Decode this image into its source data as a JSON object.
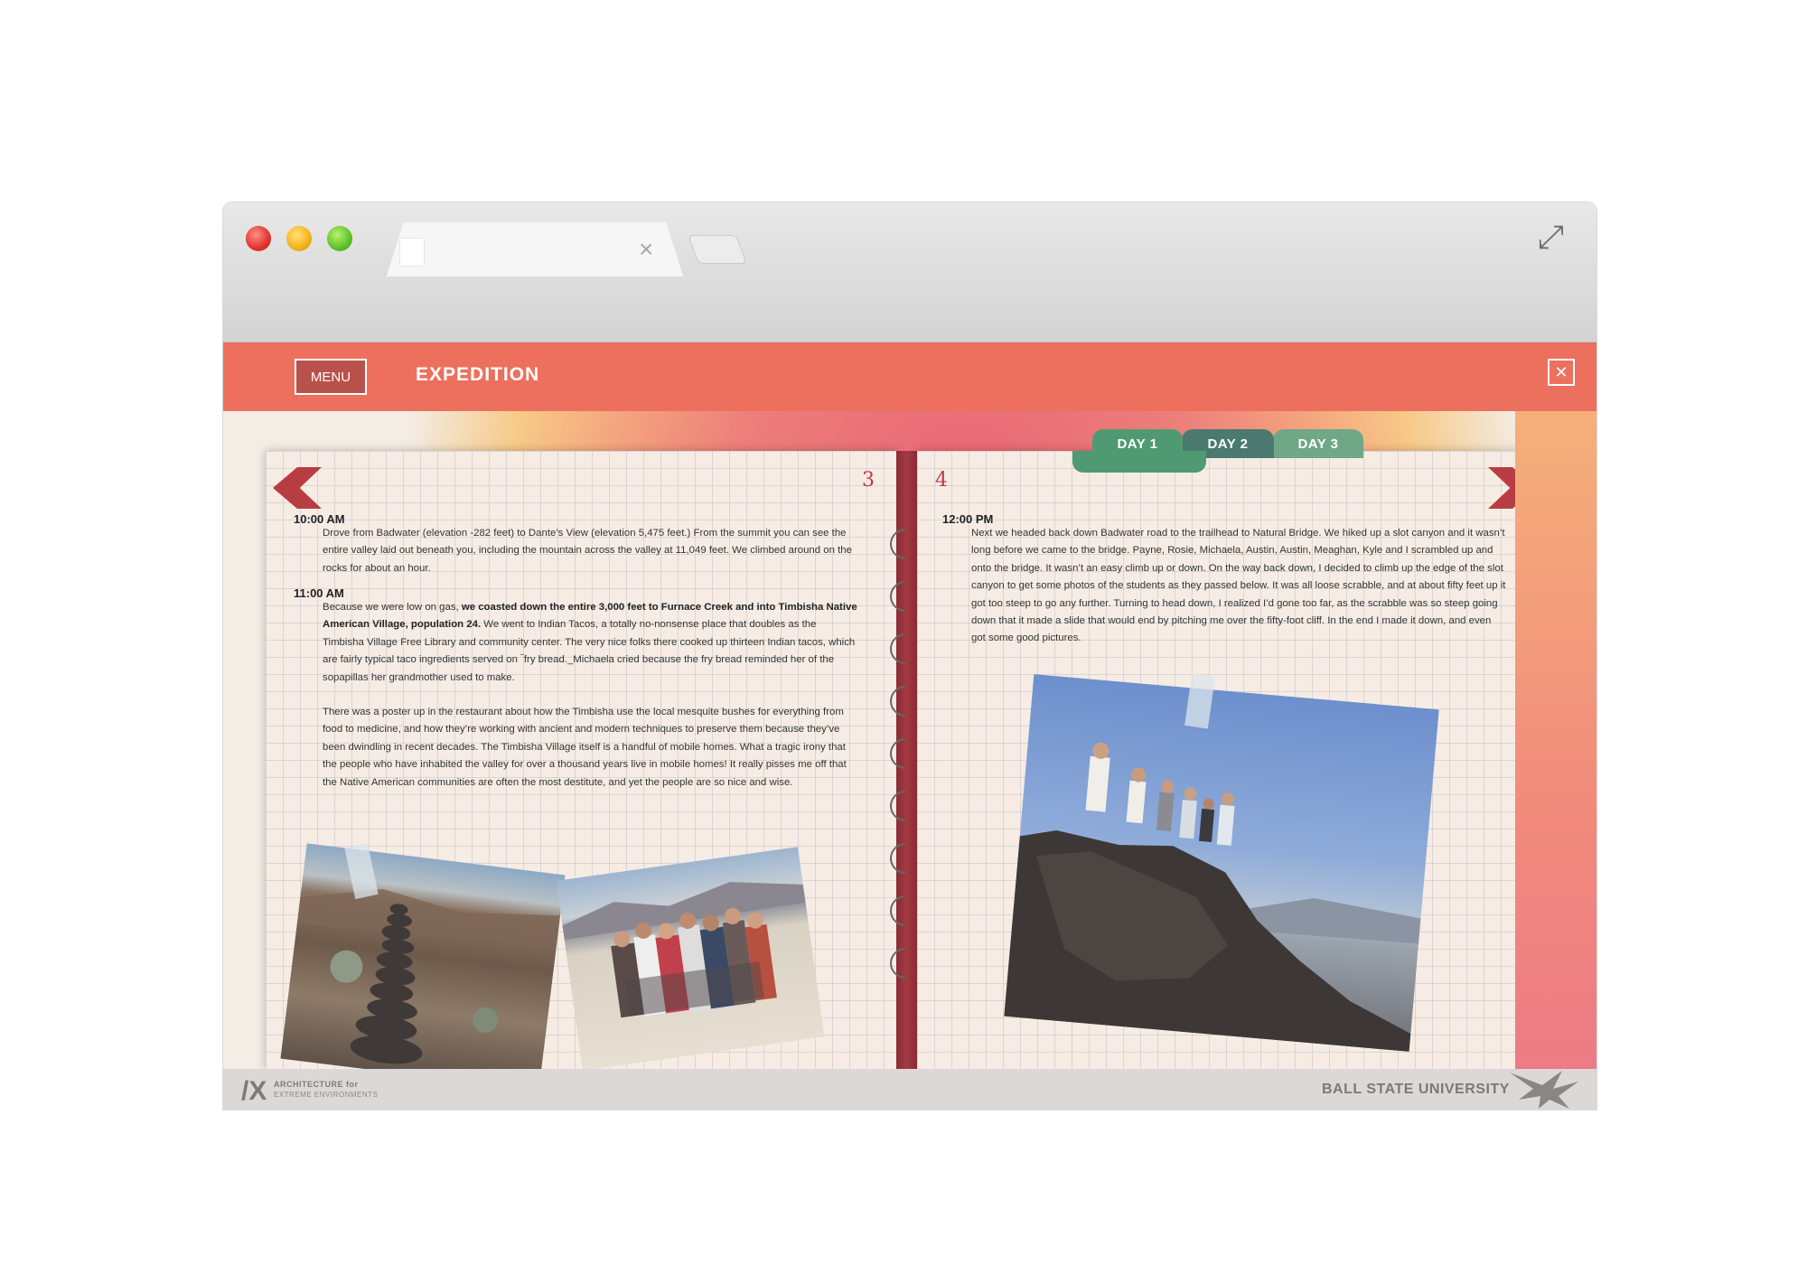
{
  "browser": {
    "tab_close": "×",
    "nav": {
      "back": "🡐",
      "forward": "🡒",
      "reload": "⟳"
    },
    "expand_icon": "⤢"
  },
  "header": {
    "menu_label": "MENU",
    "title": "EXPEDITION",
    "close_label": "✕"
  },
  "day_tabs": [
    {
      "label": "DAY 1",
      "active": true
    },
    {
      "label": "DAY 2",
      "active": false
    },
    {
      "label": "DAY 3",
      "active": false
    }
  ],
  "left_page": {
    "page_number": "3",
    "entries": [
      {
        "time": "10:00 AM",
        "text": "Drove from Badwater (elevation -282 feet) to Dante’s View (elevation 5,475 feet.) From the summit you can see the entire valley laid out beneath you, including the mountain across the valley at 11,049 feet. We climbed around on the rocks for about an hour."
      },
      {
        "time": "11:00 AM",
        "text_before_bold": "Because we were low on gas, ",
        "bold": "we coasted down the entire 3,000 feet to Furnace Creek and into Timbisha Native American Village, population 24.",
        "text_after_bold": " We went to Indian Tacos, a totally no-nonsense place that doubles as the Timbisha Village Free Library and community center. The very nice folks there cooked up thirteen Indian tacos, which are fairly typical taco ingredients served on ‾fry bread._Michaela cried because the fry bread reminded her of the sopapillas her grandmother used to make.",
        "text2": "There was a poster up in the restaurant about how the Timbisha use the local mesquite bushes for everything from food to medicine, and how they’re working with ancient and modern techniques to preserve them because they’ve been dwindling in recent decades. The Timbisha Village itself is a handful of mobile homes. What a tragic irony that the people who have inhabited the valley for over a thousand years live in mobile homes! It really pisses me off that the Native American communities are often the most destitute, and yet the people are so nice and wise."
      }
    ]
  },
  "right_page": {
    "page_number": "4",
    "entries": [
      {
        "time": "12:00 PM",
        "text": "Next we headed back down Badwater road to the trailhead to Natural Bridge. We hiked up a slot canyon and it wasn’t long before we came to the bridge. Payne, Rosie, Michaela, Austin, Austin, Meaghan, Kyle and I scrambled up and onto the bridge. It wasn’t an easy climb up or down. On the way back down, I decided to climb up the edge of the slot canyon to get some photos of the students as they passed below. It was all loose scrabble, and at about fifty feet up it got too steep to go any further. Turning to head down, I realized I’d gone too far, as the scrabble was so steep going down that it made a slide that would end by pitching me over the fifty-foot cliff. In the end I made it down, and even got some good pictures."
      }
    ]
  },
  "footer": {
    "ax_mark": "/X",
    "ax_line1": "ARCHITECTURE for",
    "ax_line2": "EXTREME ENVIRONMENTS",
    "university": "BALL STATE UNIVERSITY"
  },
  "colors": {
    "header": "#ec705d",
    "accent_red": "#b83d42",
    "tab_green": "#4f9a72"
  }
}
